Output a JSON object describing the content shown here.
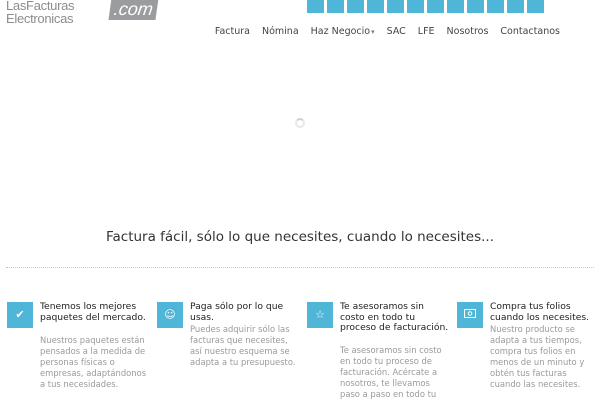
{
  "logo": {
    "line1": "LasFacturas",
    "line2": "Electronicas",
    "dotcom": ".com"
  },
  "nav": {
    "items": [
      "Factura",
      "Nómina",
      "Haz Negocio",
      "SAC",
      "LFE",
      "Nosotros",
      "Contactanos"
    ]
  },
  "tagline": "Factura fácil, sólo lo que necesites, cuando lo necesites...",
  "features": [
    {
      "icon": "check-icon",
      "title": "Tenemos los mejores paquetes del mercado.",
      "description": "Nuestros paquetes están pensados a la medida de personas físicas o empresas, adaptándonos a tus necesidades."
    },
    {
      "icon": "smiley-icon",
      "title": "Paga sólo por lo que usas.",
      "description": "Puedes adquirir sólo las facturas que necesites, así nuestro esquema se adapta a tu presupuesto."
    },
    {
      "icon": "star-icon",
      "title": "Te asesoramos sin costo en todo tu proceso de facturación.",
      "description": "Te asesoramos sin costo en todo tu proceso de facturación. Acércate a nosotros, te llevamos paso a paso en todo tu"
    },
    {
      "icon": "money-icon",
      "title": "Compra tus folios cuando los necesites.",
      "description": "Nuestro producto se adapta a tus tiempos, compra tus folios en menos de un minuto y obtén tus facturas cuando las necesites."
    }
  ],
  "colors": {
    "accent": "#4fb6d8",
    "logo_gray": "#9a9c9f",
    "text": "#333333",
    "muted": "#9a9a9a"
  }
}
